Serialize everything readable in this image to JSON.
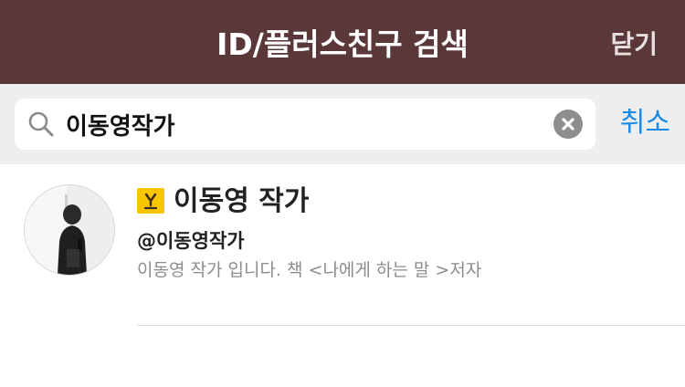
{
  "header": {
    "title": "ID/플러스친구 검색",
    "close_label": "닫기",
    "background_color": "#5a3839"
  },
  "search": {
    "query": "이동영작가",
    "icon": "search-icon",
    "clear_icon": "clear-icon",
    "cancel_label": "취소",
    "cancel_color": "#1a8ae6"
  },
  "results": [
    {
      "name": "이동영 작가",
      "badge_icon": "yellow-id-badge-icon",
      "badge_color": "#f7c600",
      "id": "@이동영작가",
      "description": "이동영 작가 입니다.  책 <나에게 하는 말 >저자",
      "avatar": "profile-photo"
    }
  ]
}
